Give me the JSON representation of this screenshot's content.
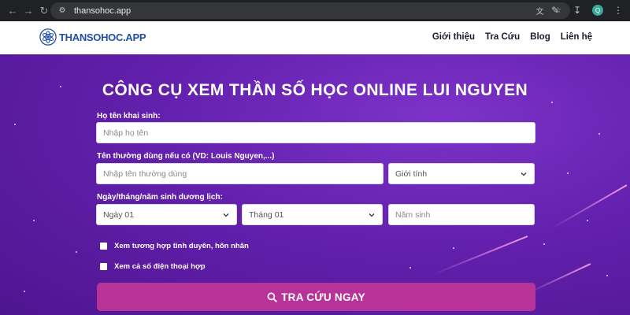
{
  "browser": {
    "url": "thansohoc.app",
    "profile_initial": "Q"
  },
  "header": {
    "logo_text": "THANSOHOC.APP",
    "menu": [
      "Giới thiệu",
      "Tra Cứu",
      "Blog",
      "Liên hệ"
    ]
  },
  "hero": {
    "title": "CÔNG CỤ XEM THẦN SỐ HỌC ONLINE LUI NGUYEN"
  },
  "form": {
    "fullname_label": "Họ tên khai sinh:",
    "fullname_placeholder": "Nhập họ tên",
    "nickname_label": "Tên thường dùng nếu có (VD: Louis Nguyen,...)",
    "nickname_placeholder": "Nhập tên thường dùng",
    "gender_value": "Giới tính",
    "dob_label": "Ngày/tháng/năm sinh dương lịch:",
    "day_value": "Ngày 01",
    "month_value": "Tháng 01",
    "year_placeholder": "Năm sinh",
    "check_compat_label": "Xem tương hợp tình duyên, hôn nhân",
    "check_phone_label": "Xem cả số điện thoại hợp",
    "submit_label": "TRA CỨU NGAY"
  },
  "colors": {
    "hero_bg": "#6320ad",
    "brand_blue": "#1f4fa6",
    "button": "#b73397"
  }
}
